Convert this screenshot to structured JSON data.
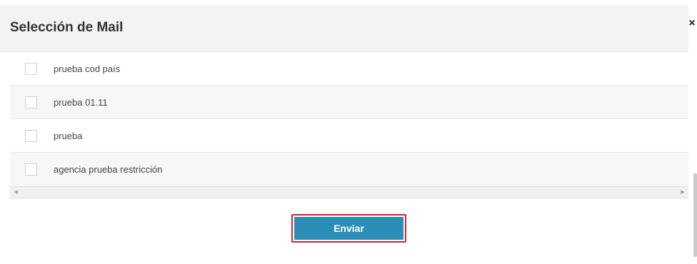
{
  "modal": {
    "title": "Selección de Mail",
    "close_symbol": "×"
  },
  "list": {
    "items": [
      {
        "label": "prueba cod país",
        "checked": false
      },
      {
        "label": "prueba 01.11",
        "checked": false
      },
      {
        "label": "prueba",
        "checked": false
      },
      {
        "label": "agencia prueba restricción",
        "checked": false
      }
    ]
  },
  "scrollbar": {
    "left_arrow": "◀",
    "right_arrow": "▶"
  },
  "footer": {
    "send_label": "Enviar"
  },
  "colors": {
    "header_bg": "#f3f3f3",
    "button_bg": "#2b8eb7",
    "button_focus_border": "#d6202b"
  }
}
